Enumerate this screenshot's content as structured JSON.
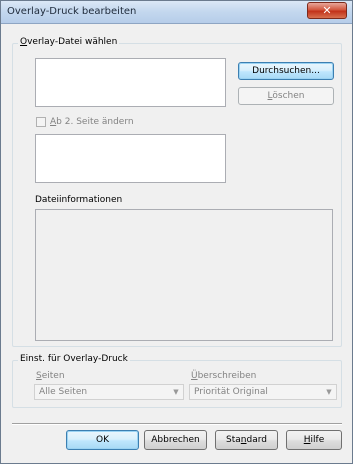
{
  "window": {
    "title": "Overlay-Druck bearbeiten",
    "close_glyph": "✕"
  },
  "overlay_group": {
    "label_prefix": "",
    "label_underlined": "O",
    "label_rest": "verlay-Datei wählen",
    "browse_button": "Durchsuchen...",
    "delete_button_underlined": "L",
    "delete_button_rest": "öschen",
    "checkbox_underlined": "A",
    "checkbox_rest": "b 2. Seite ändern",
    "checkbox_checked": false,
    "file_info_label": "Dateiinformationen"
  },
  "settings_group": {
    "label": "Einst. für Overlay-Druck",
    "pages_label_underlined": "S",
    "pages_label_rest": "eiten",
    "pages_value": "Alle Seiten",
    "overwrite_label_underlined": "Ü",
    "overwrite_label_rest": "berschreiben",
    "overwrite_value": "Priorität Original"
  },
  "buttons": {
    "ok": "OK",
    "cancel": "Abbrechen",
    "standard_prefix": "Sta",
    "standard_underlined": "n",
    "standard_rest": "dard",
    "help_underlined": "H",
    "help_rest": "ilfe"
  }
}
